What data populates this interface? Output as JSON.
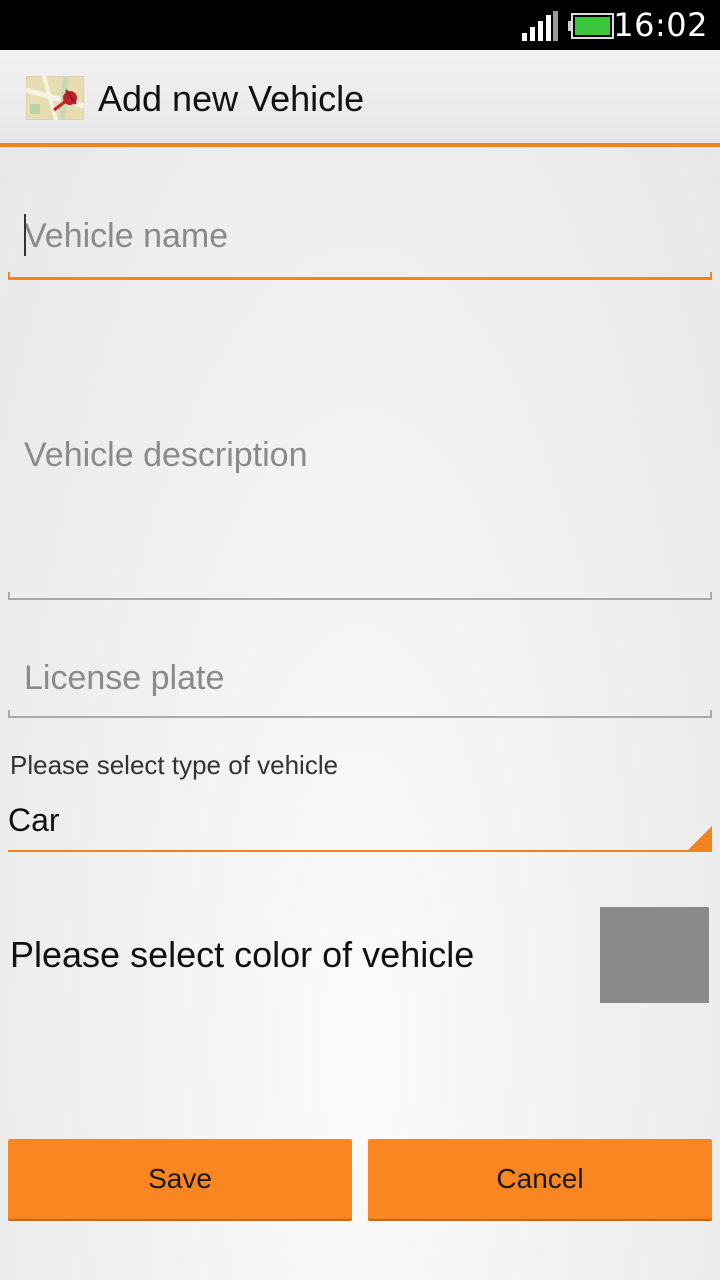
{
  "status_bar": {
    "time": "16:02",
    "signal_icon": "signal-icon",
    "battery_icon": "battery-icon"
  },
  "action_bar": {
    "title": "Add new Vehicle",
    "app_icon": "map-pin-icon",
    "accent_color": "#f0851d"
  },
  "form": {
    "vehicle_name": {
      "value": "",
      "placeholder": "Vehicle name"
    },
    "vehicle_description": {
      "value": "",
      "placeholder": "Vehicle description"
    },
    "license_plate": {
      "value": "",
      "placeholder": "License plate"
    },
    "vehicle_type": {
      "label": "Please select type of vehicle",
      "selected": "Car"
    },
    "vehicle_color": {
      "label": "Please select color of vehicle",
      "swatch_color": "#8a8a8a"
    }
  },
  "buttons": {
    "save_label": "Save",
    "cancel_label": "Cancel",
    "color": "#f98620"
  }
}
